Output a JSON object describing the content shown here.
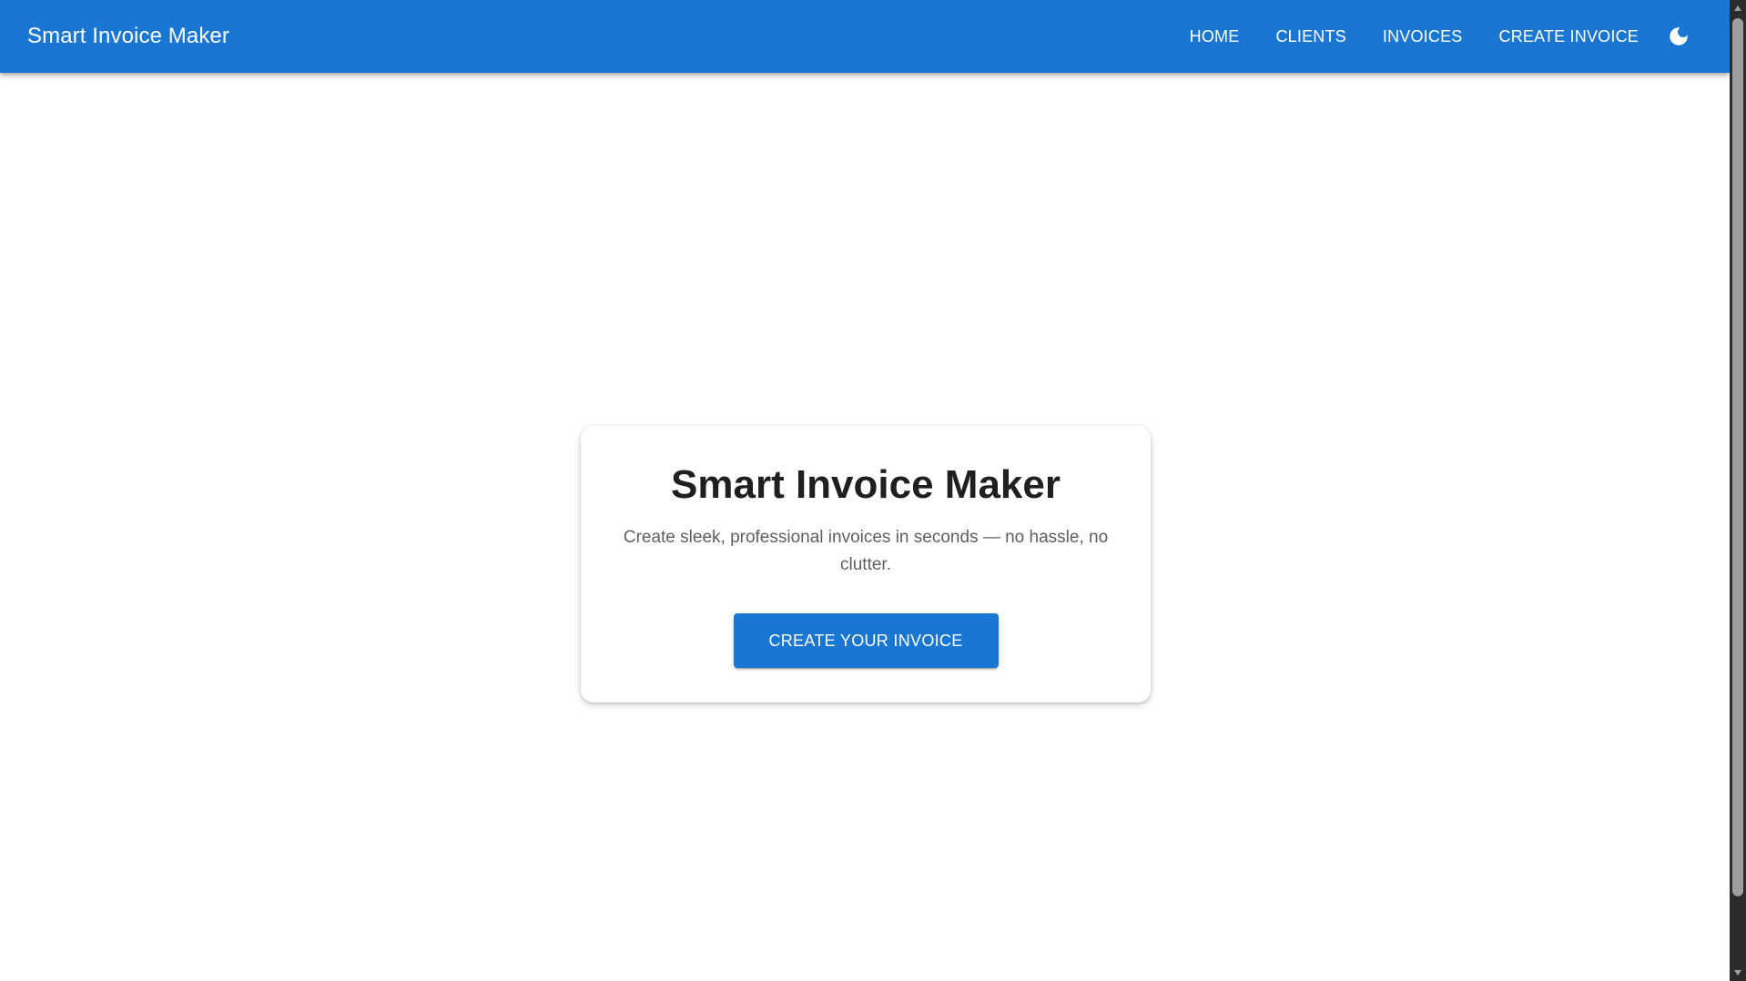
{
  "appbar": {
    "brand": "Smart Invoice Maker",
    "nav": [
      {
        "label": "HOME"
      },
      {
        "label": "CLIENTS"
      },
      {
        "label": "INVOICES"
      },
      {
        "label": "CREATE INVOICE"
      }
    ],
    "theme_toggle_icon": "moon-icon",
    "background_color": "#1976d2"
  },
  "hero": {
    "title": "Smart Invoice Maker",
    "subtitle": "Create sleek, professional invoices in seconds — no hassle, no clutter.",
    "cta_label": "CREATE YOUR INVOICE",
    "cta_color": "#1976d2"
  },
  "scrollbar": {
    "up_icon": "scroll-up-arrow-icon",
    "down_icon": "scroll-down-arrow-icon"
  }
}
